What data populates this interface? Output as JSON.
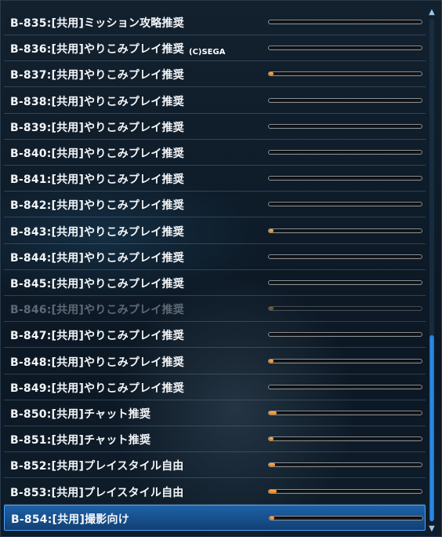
{
  "copyright": "(C)SEGA",
  "scrollbar": {
    "up_icon": "chevron-up-icon",
    "down_icon": "chevron-down-icon",
    "position_fraction": 0.63,
    "visible_fraction": 0.37
  },
  "colors": {
    "progress_fill": "#f08a1c",
    "selection": "#1a5ea0",
    "scroll_thumb": "#2a86e0"
  },
  "rows": [
    {
      "label": "B-835:[共用]ミッション攻略推奨",
      "progress": 0.0
    },
    {
      "label": "B-836:[共用]やりこみプレイ推奨",
      "progress": 0.0
    },
    {
      "label": "B-837:[共用]やりこみプレイ推奨",
      "progress": 0.03
    },
    {
      "label": "B-838:[共用]やりこみプレイ推奨",
      "progress": 0.0
    },
    {
      "label": "B-839:[共用]やりこみプレイ推奨",
      "progress": 0.0
    },
    {
      "label": "B-840:[共用]やりこみプレイ推奨",
      "progress": 0.0
    },
    {
      "label": "B-841:[共用]やりこみプレイ推奨",
      "progress": 0.0
    },
    {
      "label": "B-842:[共用]やりこみプレイ推奨",
      "progress": 0.0
    },
    {
      "label": "B-843:[共用]やりこみプレイ推奨",
      "progress": 0.03
    },
    {
      "label": "B-844:[共用]やりこみプレイ推奨",
      "progress": 0.0
    },
    {
      "label": "B-845:[共用]やりこみプレイ推奨",
      "progress": 0.0
    },
    {
      "label": "B-846:[共用]やりこみプレイ推奨",
      "progress": 0.03,
      "dim": true
    },
    {
      "label": "B-847:[共用]やりこみプレイ推奨",
      "progress": 0.0
    },
    {
      "label": "B-848:[共用]やりこみプレイ推奨",
      "progress": 0.03
    },
    {
      "label": "B-849:[共用]やりこみプレイ推奨",
      "progress": 0.0
    },
    {
      "label": "B-850:[共用]チャット推奨",
      "progress": 0.05
    },
    {
      "label": "B-851:[共用]チャット推奨",
      "progress": 0.03
    },
    {
      "label": "B-852:[共用]プレイスタイル自由",
      "progress": 0.04
    },
    {
      "label": "B-853:[共用]プレイスタイル自由",
      "progress": 0.05
    },
    {
      "label": "B-854:[共用]撮影向け",
      "progress": 0.03,
      "selected": true
    }
  ]
}
